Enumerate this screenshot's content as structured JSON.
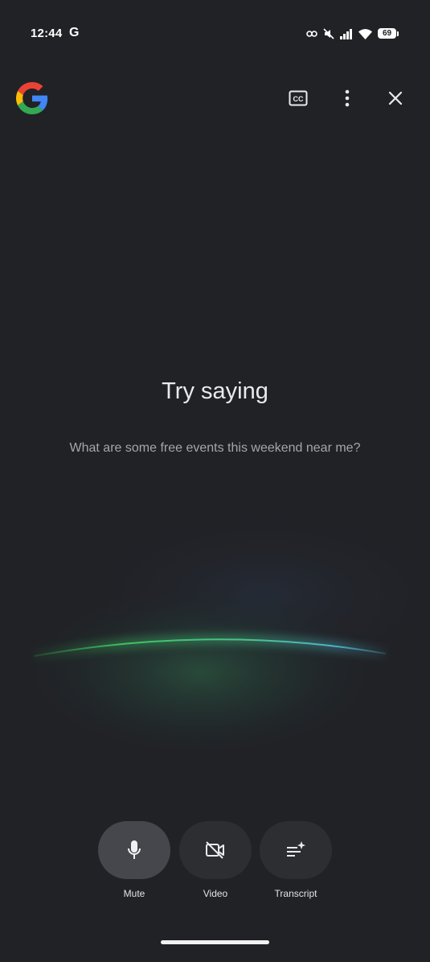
{
  "status_bar": {
    "time": "12:44",
    "notification_app": "G",
    "battery_level": "69",
    "icons": [
      "link-icon",
      "mute-icon",
      "signal-icon",
      "wifi-icon",
      "battery-icon"
    ]
  },
  "header": {
    "logo": "google-logo-icon",
    "actions": [
      "closed-captions-icon",
      "more-vert-icon",
      "close-icon"
    ]
  },
  "prompt": {
    "title": "Try saying",
    "suggestion": "What are some free events this weekend near me?"
  },
  "controls": [
    {
      "label": "Mute",
      "icon": "microphone-icon",
      "active": true
    },
    {
      "label": "Video",
      "icon": "video-off-icon",
      "active": false
    },
    {
      "label": "Transcript",
      "icon": "transcript-icon",
      "active": false
    }
  ],
  "colors": {
    "background": "#212226",
    "glow_green": "#34a853",
    "glow_teal": "#4fb3c8",
    "control_active": "#45474c",
    "control_idle": "#2c2e32"
  }
}
